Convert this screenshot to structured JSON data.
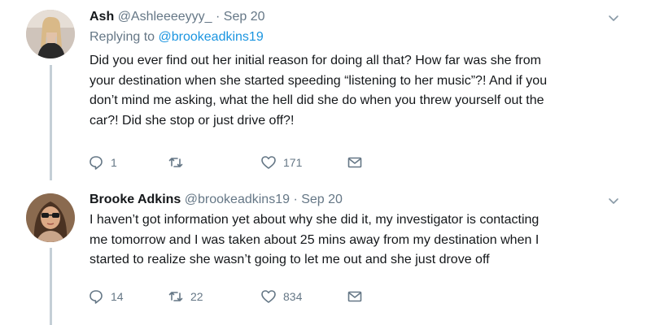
{
  "tweets": [
    {
      "name": "Ash",
      "handle": "@Ashleeeeyyy_",
      "separator": "·",
      "date": "Sep 20",
      "replying_to_prefix": "Replying to",
      "replying_to_handle": "@brookeadkins19",
      "text_lines": [
        "Did you ever find out her initial reason for doing all that? How far was she from",
        "your destination when she started speeding “listening to her music”?! And if you",
        "don’t mind me asking, what the hell did she do when you threw yourself out the",
        "car?! Did she stop or just drive off?!"
      ],
      "replies": "1",
      "retweets": "",
      "likes": "171",
      "icons": {
        "reply": "reply-icon",
        "retweet": "retweet-icon",
        "like": "heart-icon",
        "dm": "envelope-icon",
        "more": "chevron-down-icon"
      }
    },
    {
      "name": "Brooke Adkins",
      "handle": "@brookeadkins19",
      "separator": "·",
      "date": "Sep 20",
      "text_lines": [
        "I haven’t got information yet about why she did it, my investigator is contacting",
        "me tomorrow and I was taken about 25 mins away from my destination when I",
        "started to realize she wasn’t going to let me out and she just drove off"
      ],
      "replies": "14",
      "retweets": "22",
      "likes": "834",
      "icons": {
        "reply": "reply-icon",
        "retweet": "retweet-icon",
        "like": "heart-icon",
        "dm": "envelope-icon",
        "more": "chevron-down-icon"
      }
    }
  ],
  "colors": {
    "text": "#14171a",
    "secondary": "#657786",
    "link": "#1b95e0",
    "thread_line": "#c4cfd6"
  }
}
